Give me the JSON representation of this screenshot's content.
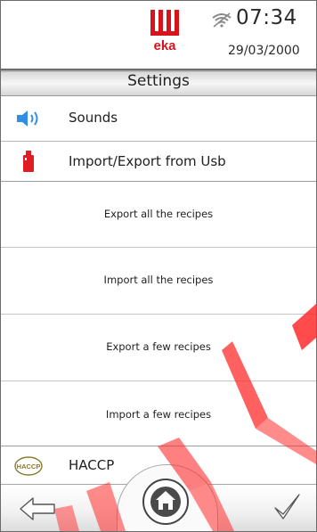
{
  "header": {
    "brand": "eka",
    "time": "07:34",
    "date": "29/03/2000"
  },
  "title": "Settings",
  "menu": {
    "sounds_label": "Sounds",
    "usb_label": "Import/Export from Usb",
    "usb_actions": [
      "Export all the recipes",
      "Import all the recipes",
      "Export a few recipes",
      "Import a few recipes"
    ],
    "haccp_label": "HACCP",
    "haccp_icon_text": "HACCP"
  },
  "icons": {
    "sounds": "speaker-icon",
    "usb": "usb-drive-icon",
    "haccp": "haccp-badge-icon",
    "back": "back-arrow-icon",
    "home": "home-icon",
    "confirm": "checkmark-icon",
    "wifi": "wifi-icon"
  },
  "colors": {
    "brand_red": "#d7141b",
    "speaker_blue": "#2f8fe6",
    "usb_red": "#e01b24",
    "haccp_olive": "#8a7a2e",
    "watermark": "#ff2b2b"
  }
}
